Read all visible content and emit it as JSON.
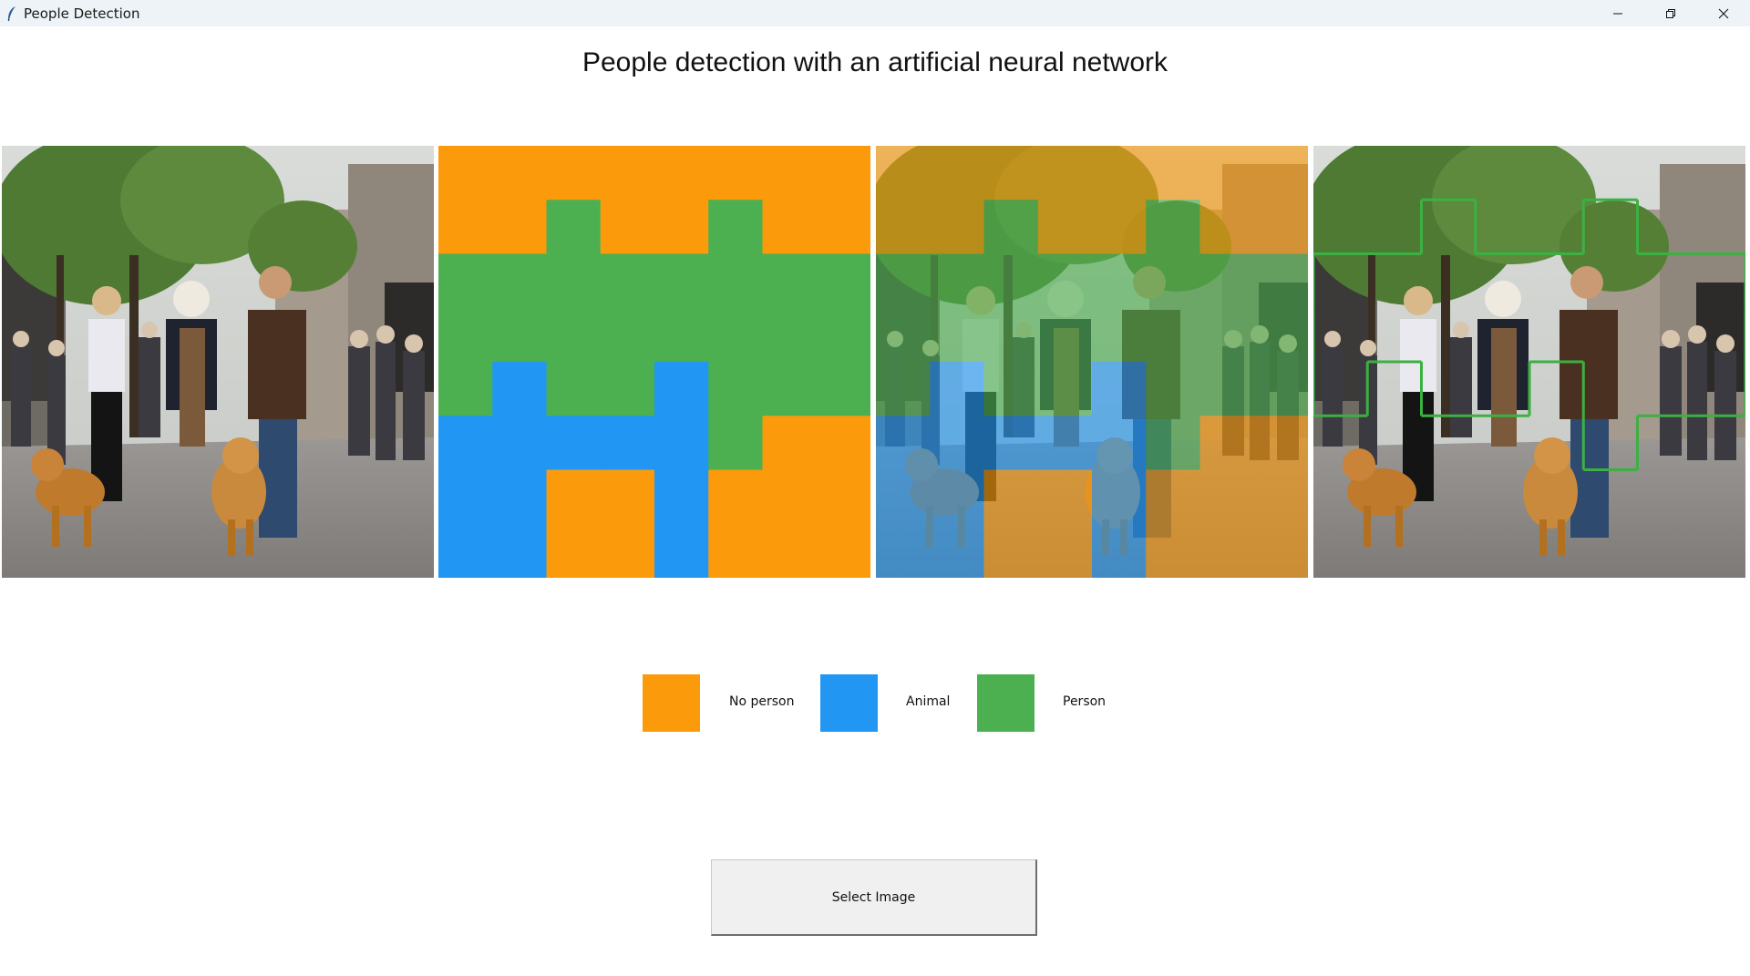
{
  "window": {
    "title": "People Detection",
    "controls": [
      "minimize",
      "restore",
      "close"
    ]
  },
  "heading": "People detection with an artificial neural network",
  "colors": {
    "no_person": "#FB9A0B",
    "animal": "#2196F3",
    "person": "#4CAF50",
    "button_bg": "#F0F0F0"
  },
  "panels": [
    {
      "name": "original-image",
      "content": "street scene photo"
    },
    {
      "name": "classification-grid",
      "content": "color grid"
    },
    {
      "name": "overlay-image",
      "content": "photo with color grid overlay"
    },
    {
      "name": "detection-outline-image",
      "content": "photo with green person outline"
    }
  ],
  "grid": {
    "rows": 4,
    "cols": 8,
    "cells": [
      [
        "N",
        "N",
        "N",
        "N",
        "N",
        "N",
        "N",
        "N"
      ],
      [
        "N",
        "N",
        "P",
        "N",
        "N",
        "P",
        "N",
        "N"
      ],
      [
        "P",
        "P",
        "P",
        "P",
        "P",
        "P",
        "P",
        "P"
      ],
      [
        "P",
        "P",
        "P",
        "P",
        "P",
        "P",
        "P",
        "P"
      ],
      [
        "P",
        "A",
        "P",
        "P",
        "A",
        "P",
        "P",
        "P"
      ],
      [
        "A",
        "A",
        "A",
        "A",
        "A",
        "P",
        "N",
        "N"
      ],
      [
        "A",
        "A",
        "N",
        "N",
        "A",
        "N",
        "N",
        "N"
      ],
      [
        "A",
        "A",
        "N",
        "N",
        "A",
        "N",
        "N",
        "N"
      ]
    ]
  },
  "legend": [
    {
      "key": "N",
      "label": "No person",
      "color": "#FB9A0B"
    },
    {
      "key": "A",
      "label": "Animal",
      "color": "#2196F3"
    },
    {
      "key": "P",
      "label": "Person",
      "color": "#4CAF50"
    }
  ],
  "button": {
    "label": "Select Image"
  }
}
